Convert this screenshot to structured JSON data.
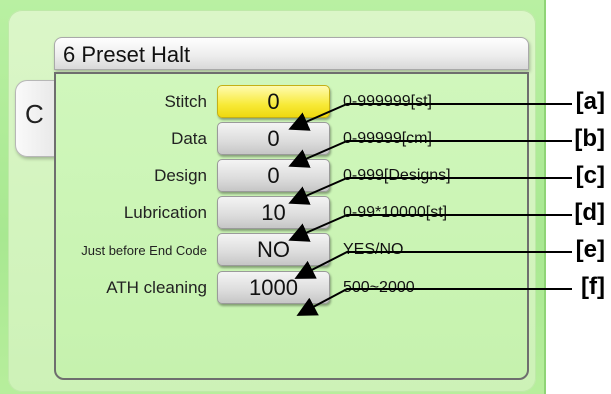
{
  "header": {
    "title": "6 Preset Halt"
  },
  "tab": {
    "label": "C"
  },
  "rows": [
    {
      "label": "Stitch",
      "value": "0",
      "range": "0-999999[st]",
      "active": true
    },
    {
      "label": "Data",
      "value": "0",
      "range": "0-99999[cm]",
      "active": false
    },
    {
      "label": "Design",
      "value": "0",
      "range": "0-999[Designs]",
      "active": false
    },
    {
      "label": "Lubrication",
      "value": "10",
      "range": "0-99*10000[st]",
      "active": false
    },
    {
      "label": "Just before End Code",
      "value": "NO",
      "range": "YES/NO",
      "active": false
    },
    {
      "label": "ATH cleaning",
      "value": "1000",
      "range": "500~2000",
      "active": false
    }
  ],
  "callouts": [
    "[a]",
    "[b]",
    "[c]",
    "[d]",
    "[e]",
    "[f]"
  ],
  "colors": {
    "frame": "#a8e891",
    "panel": "#c9f4b3",
    "active_button": "#f8ea38",
    "button": "#dcdcdc"
  }
}
